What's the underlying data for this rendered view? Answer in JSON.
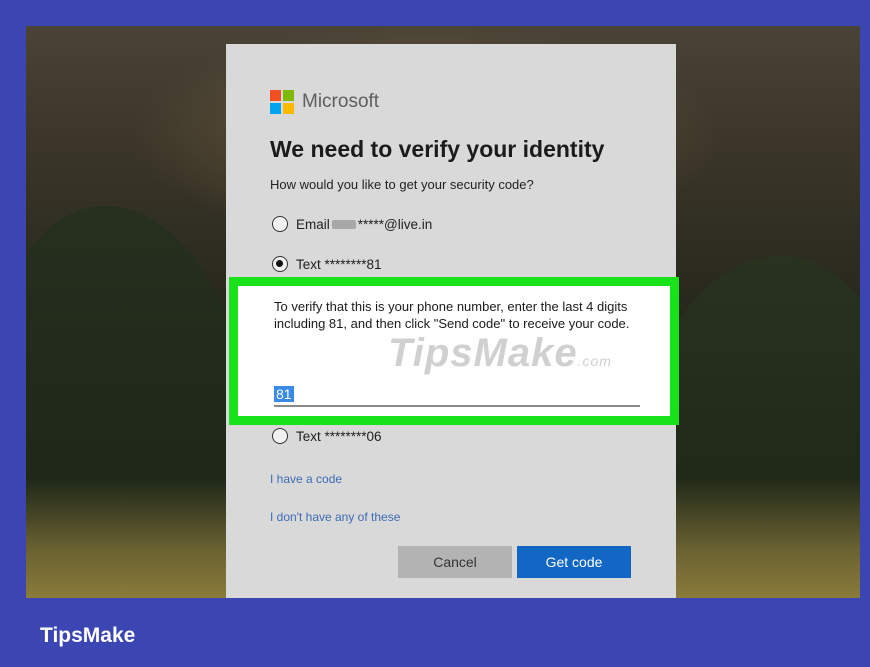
{
  "dialog": {
    "brand_name": "Microsoft",
    "logo_colors": [
      "#f25022",
      "#7fba00",
      "#00a4ef",
      "#ffb900"
    ],
    "title": "We need to verify your identity",
    "subtitle": "How would you like to get your security code?",
    "options": [
      {
        "prefix": "Email",
        "suffix": "*****@live.in",
        "selected": false
      },
      {
        "label": "Text ********81",
        "selected": true
      },
      {
        "label": "Text ********06",
        "selected": false
      }
    ],
    "instructions": "To verify that this is your phone number, enter the last 4 digits including 81, and then click \"Send code\" to receive your code.",
    "code_value": "81",
    "links": {
      "have_code": "I have a code",
      "no_options": "I don't have any of these"
    },
    "buttons": {
      "cancel": "Cancel",
      "get_code": "Get code"
    }
  },
  "watermark": {
    "main": "TipsMake",
    "suffix": ".com"
  },
  "footer_brand": "TipsMake",
  "colors": {
    "highlight_border": "#18e31a",
    "primary_button": "#1367c4",
    "frame": "#3b46b3"
  }
}
